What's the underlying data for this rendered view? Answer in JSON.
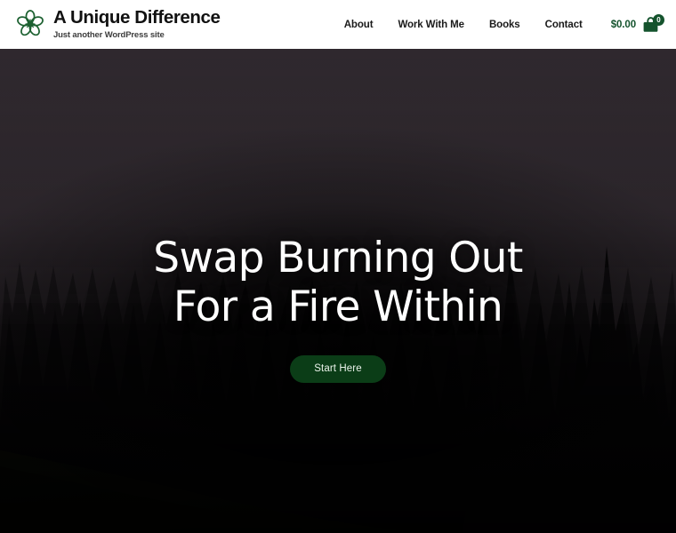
{
  "header": {
    "logo_icon": "flower-blossom-icon",
    "site_title": "A Unique Difference",
    "tagline": "Just another WordPress site",
    "brand_color": "#14532d",
    "nav": [
      {
        "label": "About"
      },
      {
        "label": "Work With Me"
      },
      {
        "label": "Books"
      },
      {
        "label": "Contact"
      }
    ],
    "cart": {
      "total": "$0.00",
      "icon": "shopping-bag-icon",
      "count": "0"
    }
  },
  "hero": {
    "background_image": "dark-misty-pine-forest-photo",
    "sky_color": "#332c32",
    "title_line_1": "Swap Burning Out",
    "title_line_2": "For a Fire Within",
    "cta_label": "Start Here",
    "cta_background": "#0b3d17",
    "cta_text_color": "#eaf3ea"
  }
}
